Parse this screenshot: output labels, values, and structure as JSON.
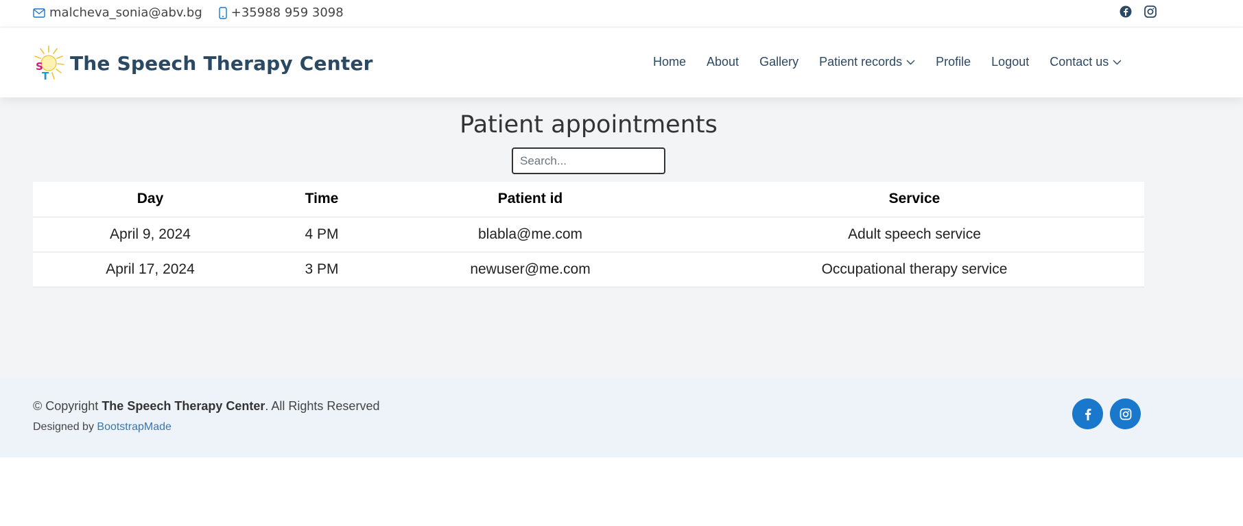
{
  "topbar": {
    "email": "malcheva_sonia@abv.bg",
    "phone": "+35988 959 3098",
    "icons": [
      "envelope-icon",
      "phone-icon",
      "facebook-icon",
      "instagram-icon"
    ]
  },
  "header": {
    "logo_letters": [
      "S",
      "T"
    ],
    "site_title": "The Speech Therapy Center",
    "nav": [
      {
        "label": "Home",
        "dropdown": false
      },
      {
        "label": "About",
        "dropdown": false
      },
      {
        "label": "Gallery",
        "dropdown": false
      },
      {
        "label": "Patient records",
        "dropdown": true
      },
      {
        "label": "Profile",
        "dropdown": false
      },
      {
        "label": "Logout",
        "dropdown": false
      },
      {
        "label": "Contact us",
        "dropdown": true
      }
    ]
  },
  "main": {
    "title": "Patient appointments",
    "search_placeholder": "Search...",
    "columns": [
      "Day",
      "Time",
      "Patient id",
      "Service"
    ],
    "rows": [
      [
        "April 9, 2024",
        "4 PM",
        "blabla@me.com",
        "Adult speech service"
      ],
      [
        "April 17, 2024",
        "3 PM",
        "newuser@me.com",
        "Occupational therapy service"
      ]
    ]
  },
  "footer": {
    "copyright_prefix": "© Copyright ",
    "brand": "The Speech Therapy Center",
    "copyright_suffix": ". All Rights Reserved",
    "designed_by": "Designed by ",
    "designer_link": "BootstrapMade"
  },
  "colors": {
    "brand": "#2c4964",
    "accent": "#1977cc",
    "main_bg": "#f3f4f6",
    "footer_bg": "#eef3fa"
  }
}
